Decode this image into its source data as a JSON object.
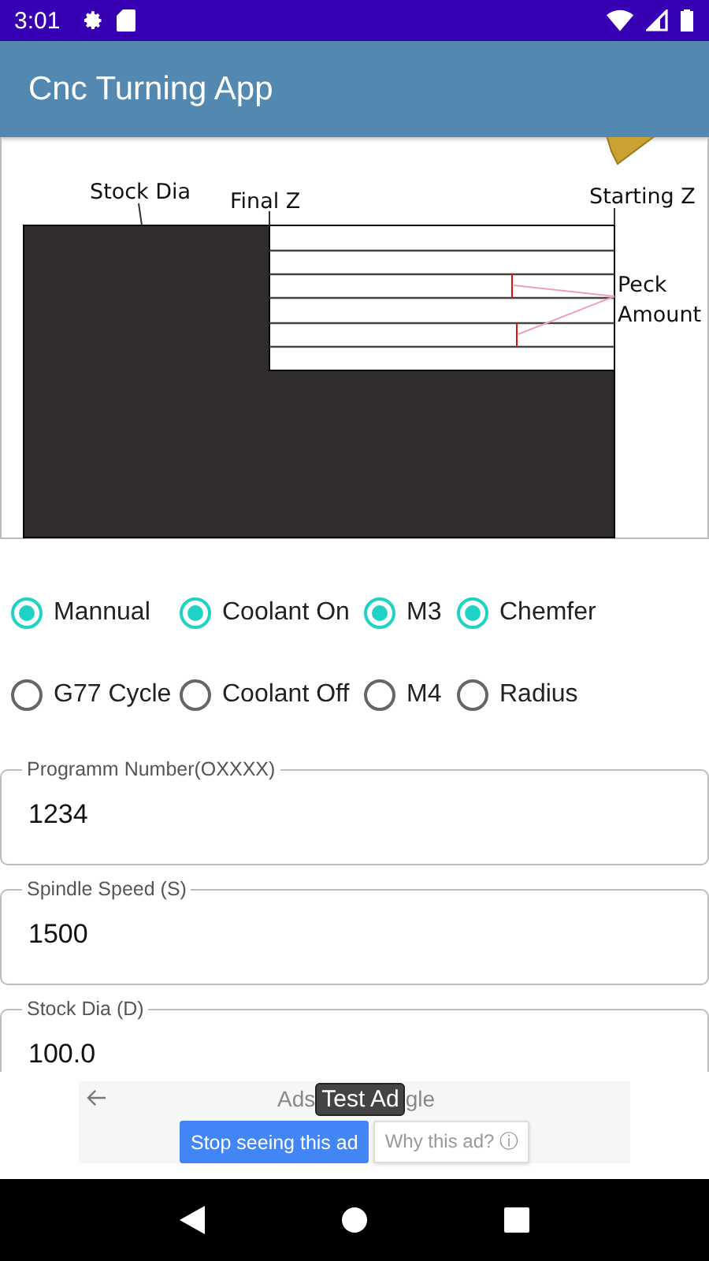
{
  "status_bar": {
    "time": "3:01"
  },
  "app_bar": {
    "title": "Cnc Turning App"
  },
  "diagram": {
    "labels": [
      {
        "kind": "stock",
        "text": "Stock Dia"
      },
      {
        "kind": "final",
        "text": "Final Z"
      },
      {
        "kind": "start",
        "text": "Starting Z"
      },
      {
        "kind": "peck1",
        "text": "Peck"
      },
      {
        "kind": "peck2",
        "text": "Amount"
      }
    ]
  },
  "option_rows": [
    [
      {
        "label": "Mannual",
        "selected": true
      },
      {
        "label": "Coolant On",
        "selected": true
      },
      {
        "label": "M3",
        "selected": true
      },
      {
        "label": "Chemfer",
        "selected": true
      }
    ],
    [
      {
        "label": "G77 Cycle",
        "selected": false
      },
      {
        "label": "Coolant Off",
        "selected": false
      },
      {
        "label": "M4",
        "selected": false
      },
      {
        "label": "Radius",
        "selected": false
      }
    ]
  ],
  "fields": [
    {
      "label": "Programm Number(OXXXX)",
      "value": "1234"
    },
    {
      "label": "Spindle Speed (S)",
      "value": "1500"
    },
    {
      "label": "Stock Dia (D)",
      "value": "100.0"
    }
  ],
  "ad": {
    "header_left": "Ads",
    "header_right": "gle",
    "badge": "Test Ad",
    "stop_button": "Stop seeing this ad",
    "why_button": "Why this ad? ⓘ"
  }
}
